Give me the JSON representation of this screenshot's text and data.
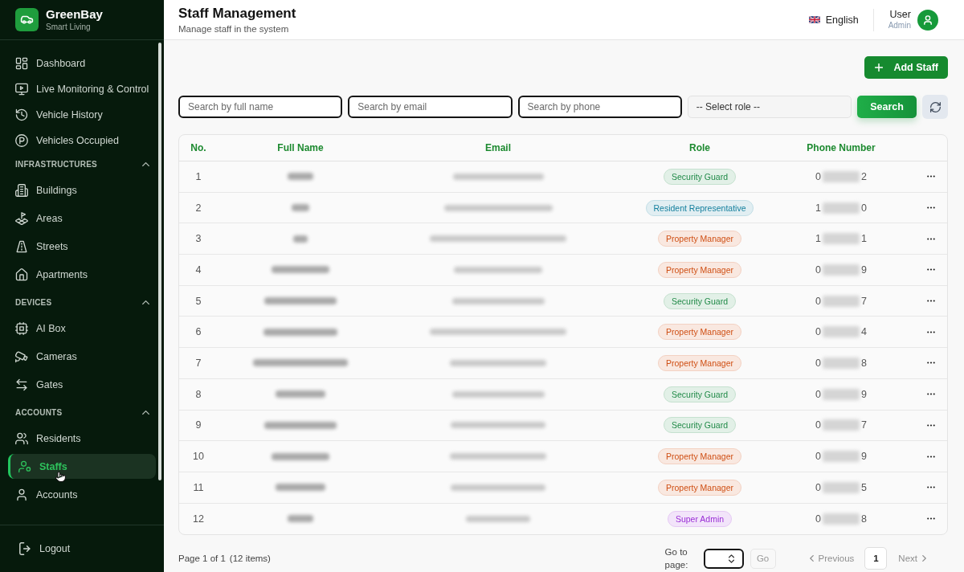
{
  "sidebar": {
    "brand": {
      "name": "GreenBay",
      "tagline": "Smart Living"
    },
    "sections": [
      {
        "items": [
          {
            "label": "Dashboard",
            "selected": false
          },
          {
            "label": "Live Monitoring & Control",
            "selected": false
          },
          {
            "label": "Vehicle History",
            "selected": false
          },
          {
            "label": "Vehicles Occupied",
            "selected": false
          }
        ]
      },
      {
        "title": "INFRASTRUCTURES",
        "expanded": true,
        "items": [
          {
            "label": "Buildings",
            "selected": false
          },
          {
            "label": "Areas",
            "selected": false
          },
          {
            "label": "Streets",
            "selected": false
          },
          {
            "label": "Apartments",
            "selected": false
          }
        ]
      },
      {
        "title": "DEVICES",
        "expanded": true,
        "items": [
          {
            "label": "AI Box",
            "selected": false
          },
          {
            "label": "Cameras",
            "selected": false
          },
          {
            "label": "Gates",
            "selected": false
          }
        ]
      },
      {
        "title": "ACCOUNTS",
        "expanded": true,
        "items": [
          {
            "label": "Residents",
            "selected": false
          },
          {
            "label": "Staffs",
            "selected": true
          },
          {
            "label": "Accounts",
            "selected": false
          }
        ]
      }
    ],
    "logout": "Logout"
  },
  "header": {
    "title": "Staff Management",
    "subtitle": "Manage staff in the system",
    "language": "English",
    "user": {
      "name": "User",
      "role": "Admin"
    }
  },
  "toolbar": {
    "add_button": "Add Staff"
  },
  "filters": [
    {
      "kind": "text",
      "placeholder": "Search by full name"
    },
    {
      "kind": "text",
      "placeholder": "Search by email"
    },
    {
      "kind": "text",
      "placeholder": "Search by phone"
    },
    {
      "kind": "select",
      "value": "-- Select role --"
    }
  ],
  "search_button": "Search",
  "table": {
    "columns": [
      "No.",
      "Full Name",
      "Email",
      "Role",
      "Phone Number"
    ],
    "rows": [
      {
        "no": "1",
        "role": {
          "label": "Security Guard",
          "color": "#218a48"
        },
        "phone": {
          "start": "0",
          "end": "2"
        }
      },
      {
        "no": "2",
        "role": {
          "label": "Resident Representative",
          "color": "#16809e"
        },
        "phone": {
          "start": "1",
          "end": "0"
        }
      },
      {
        "no": "3",
        "role": {
          "label": "Property Manager",
          "color": "#cf4f14"
        },
        "phone": {
          "start": "1",
          "end": "1"
        }
      },
      {
        "no": "4",
        "role": {
          "label": "Property Manager",
          "color": "#cf4f14"
        },
        "phone": {
          "start": "0",
          "end": "9"
        }
      },
      {
        "no": "5",
        "role": {
          "label": "Security Guard",
          "color": "#218a48"
        },
        "phone": {
          "start": "0",
          "end": "7"
        }
      },
      {
        "no": "6",
        "role": {
          "label": "Property Manager",
          "color": "#cf4f14"
        },
        "phone": {
          "start": "0",
          "end": "4"
        }
      },
      {
        "no": "7",
        "role": {
          "label": "Property Manager",
          "color": "#cf4f14"
        },
        "phone": {
          "start": "0",
          "end": "8"
        }
      },
      {
        "no": "8",
        "role": {
          "label": "Security Guard",
          "color": "#218a48"
        },
        "phone": {
          "start": "0",
          "end": "9"
        }
      },
      {
        "no": "9",
        "role": {
          "label": "Security Guard",
          "color": "#218a48"
        },
        "phone": {
          "start": "0",
          "end": "7"
        }
      },
      {
        "no": "10",
        "role": {
          "label": "Property Manager",
          "color": "#cf4f14"
        },
        "phone": {
          "start": "0",
          "end": "9"
        }
      },
      {
        "no": "11",
        "role": {
          "label": "Property Manager",
          "color": "#cf4f14"
        },
        "phone": {
          "start": "0",
          "end": "5"
        }
      },
      {
        "no": "12",
        "role": {
          "label": "Super Admin",
          "color": "#9b2fd6"
        },
        "phone": {
          "start": "0",
          "end": "8"
        }
      }
    ]
  },
  "footer": {
    "page_info": "Page 1 of 1",
    "item_count": "(12 items)",
    "goto_label": "Go to page:",
    "go_button": {
      "label": "Go",
      "disabled": true
    },
    "previous": {
      "label": "Previous",
      "disabled": true
    },
    "pages": [
      {
        "label": "1",
        "selected": true
      }
    ],
    "next": {
      "label": "Next",
      "disabled": true
    }
  }
}
